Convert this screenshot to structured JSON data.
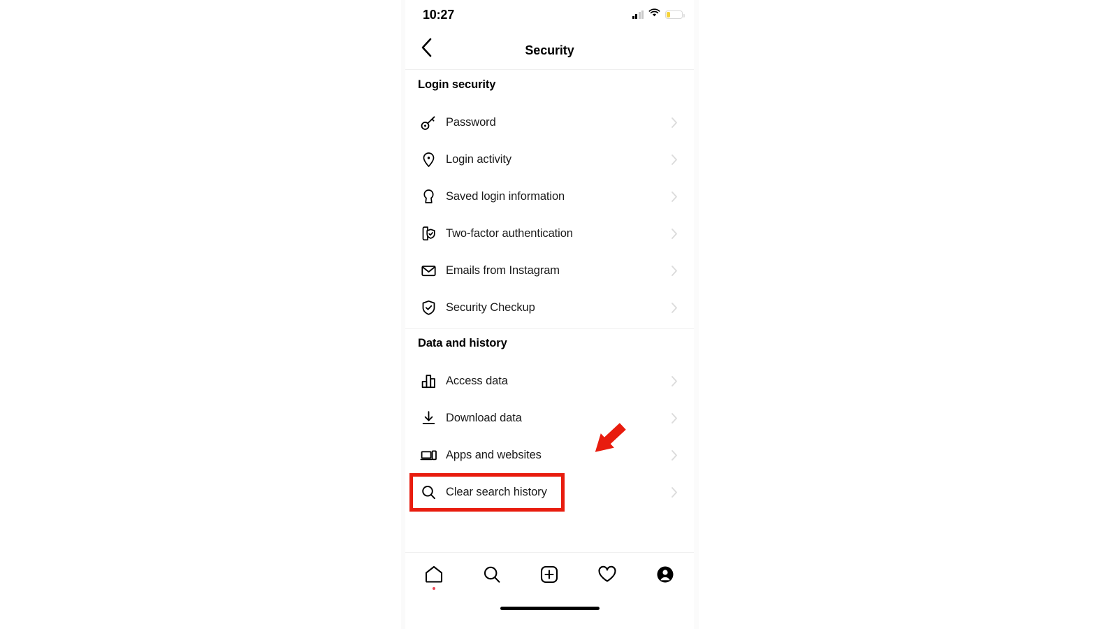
{
  "status_bar": {
    "time": "10:27",
    "cell_icon": "cellular-signal-icon",
    "wifi_icon": "wifi-icon",
    "battery_icon": "battery-low-icon",
    "battery_color": "#f5d33b"
  },
  "header": {
    "back_icon": "chevron-left-icon",
    "title": "Security"
  },
  "sections": [
    {
      "title": "Login security",
      "items": [
        {
          "label": "Password",
          "icon": "key-icon",
          "chevron": "chevron-right-icon"
        },
        {
          "label": "Login activity",
          "icon": "location-pin-icon",
          "chevron": "chevron-right-icon"
        },
        {
          "label": "Saved login information",
          "icon": "keyhole-icon",
          "chevron": "chevron-right-icon"
        },
        {
          "label": "Two-factor authentication",
          "icon": "phone-shield-check-icon",
          "chevron": "chevron-right-icon"
        },
        {
          "label": "Emails from Instagram",
          "icon": "envelope-icon",
          "chevron": "chevron-right-icon"
        },
        {
          "label": "Security Checkup",
          "icon": "shield-check-icon",
          "chevron": "chevron-right-icon"
        }
      ]
    },
    {
      "title": "Data and history",
      "items": [
        {
          "label": "Access data",
          "icon": "bar-chart-icon",
          "chevron": "chevron-right-icon"
        },
        {
          "label": "Download data",
          "icon": "download-icon",
          "chevron": "chevron-right-icon"
        },
        {
          "label": "Apps and websites",
          "icon": "laptop-phone-icon",
          "chevron": "chevron-right-icon"
        },
        {
          "label": "Clear search history",
          "icon": "magnifier-icon",
          "chevron": "chevron-right-icon"
        }
      ]
    }
  ],
  "tab_bar": {
    "tabs": [
      {
        "name": "home",
        "icon": "home-icon",
        "has_notification_dot": true
      },
      {
        "name": "search",
        "icon": "search-icon",
        "has_notification_dot": false
      },
      {
        "name": "create",
        "icon": "plus-square-icon",
        "has_notification_dot": false
      },
      {
        "name": "activity",
        "icon": "heart-icon",
        "has_notification_dot": false
      },
      {
        "name": "profile",
        "icon": "profile-avatar-icon",
        "has_notification_dot": false
      }
    ],
    "notification_dot_color": "#ed4956"
  },
  "annotations": {
    "highlight_color": "#e81c0e",
    "highlight_target": "Clear search history",
    "arrow_icon": "red-arrow-down-left-icon",
    "arrow_color": "#e81c0e"
  }
}
